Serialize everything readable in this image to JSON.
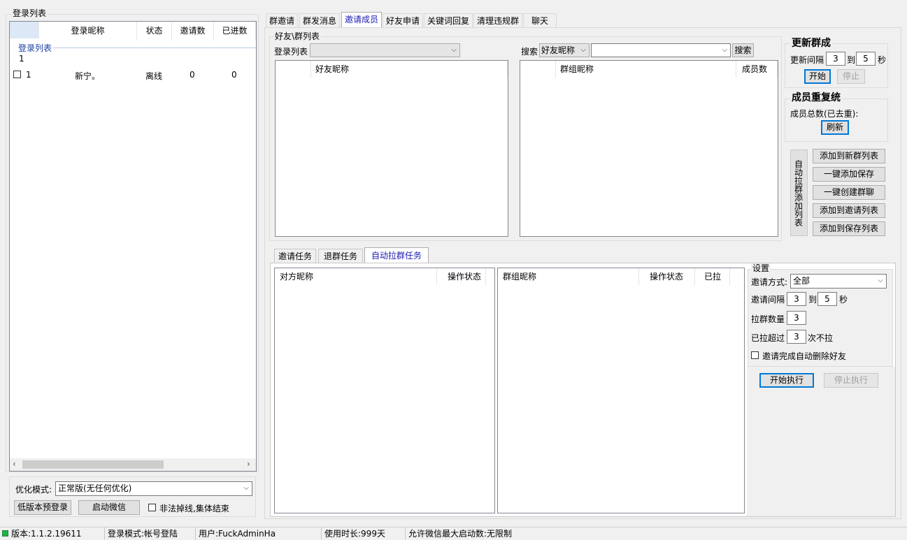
{
  "left_panel": {
    "title": "登录列表",
    "table": {
      "headers": [
        "",
        "登录昵称",
        "状态",
        "邀请数",
        "已进数"
      ],
      "group_label": "登录列表",
      "group_count": "1",
      "rows": [
        {
          "index": "1",
          "nickname": "新宁。",
          "status": "离线",
          "invites": "0",
          "joined": "0"
        }
      ]
    },
    "opt_mode_label": "优化模式:",
    "opt_mode_value": "正常版(无任何优化)",
    "low_version_btn": "低版本预登录",
    "start_wechat_btn": "启动微信",
    "illegal_drop_label": "非法掉线,集体结束"
  },
  "tabs": {
    "items": [
      "群邀请",
      "群发消息",
      "邀请成员",
      "好友申请",
      "关键词回复",
      "清理违规群",
      "聊天"
    ],
    "active": "邀请成员"
  },
  "friend_group": {
    "title": "好友\\群列表",
    "login_list_label": "登录列表",
    "login_list_value": "",
    "search_label": "搜索",
    "search_type": "好友昵称",
    "search_value": "",
    "search_btn": "搜索",
    "friend_list_header": "好友昵称",
    "group_list_headers": [
      "群组昵称",
      "成员数"
    ]
  },
  "update_group": {
    "title": "更新群成",
    "interval_label": "更新间隔",
    "from": "3",
    "to_label": "到",
    "to": "5",
    "unit": "秒",
    "start_btn": "开始",
    "stop_btn": "停止"
  },
  "member_dedup": {
    "title": "成员重复统",
    "total_label": "成员总数(已去重):",
    "refresh_btn": "刷新"
  },
  "auto_pull": {
    "side_label": "自动拉群添加列表",
    "buttons": [
      "添加到新群列表",
      "一键添加保存",
      "一键创建群聊",
      "添加到邀请列表",
      "添加到保存列表"
    ]
  },
  "task_tabs": {
    "items": [
      "邀请任务",
      "退群任务",
      "自动拉群任务"
    ],
    "active": "自动拉群任务"
  },
  "task_lists": {
    "left_headers": [
      "对方昵称",
      "操作状态"
    ],
    "right_headers": [
      "群组昵称",
      "操作状态",
      "已拉"
    ]
  },
  "settings": {
    "title": "设置",
    "invite_mode_label": "邀请方式:",
    "invite_mode_value": "全部",
    "invite_interval_label": "邀请间隔",
    "interval_from": "3",
    "to_label": "到",
    "interval_to": "5",
    "unit": "秒",
    "pull_count_label": "拉群数量",
    "pull_count": "3",
    "pulled_over_label": "已拉超过",
    "pulled_over": "3",
    "times_label": "次不拉",
    "auto_delete_label": "邀请完成自动删除好友",
    "start_btn": "开始执行",
    "stop_btn": "停止执行"
  },
  "status_bar": {
    "version": "版本:1.1.2.19611",
    "login_mode": "登录模式:帐号登陆",
    "user": "用户:FuckAdminHa",
    "usage": "使用时长:999天",
    "max_launch": "允许微信最大启动数:无限制",
    "indicator_color": "#22b14c"
  }
}
